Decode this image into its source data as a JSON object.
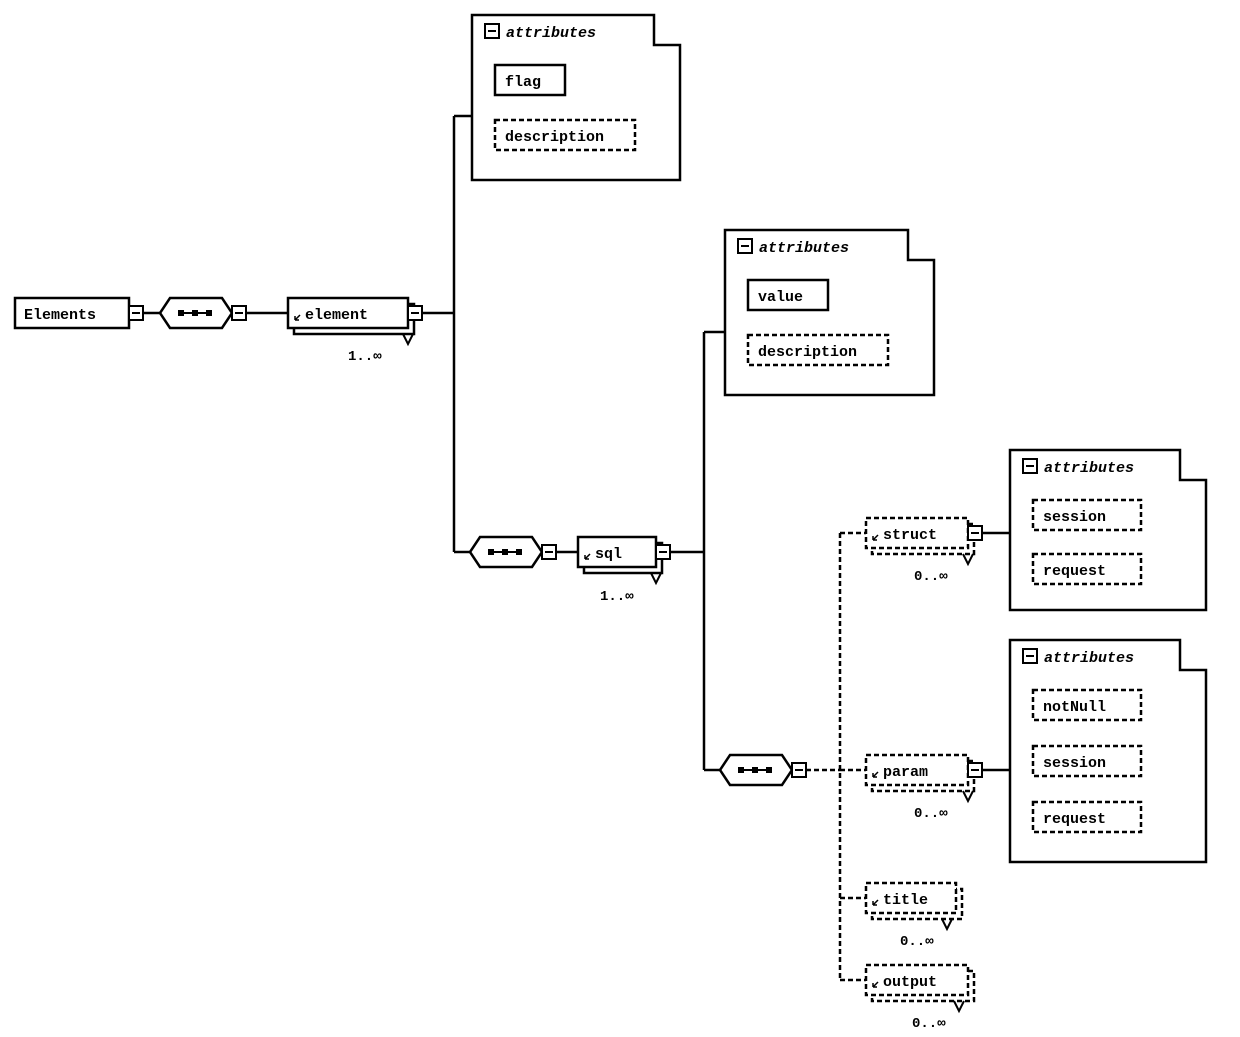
{
  "nodes": {
    "root": "Elements",
    "element": "element",
    "sql": "sql",
    "struct": "struct",
    "param": "param",
    "title": "title",
    "output": "output"
  },
  "attributes": {
    "element": {
      "title": "attributes",
      "items": [
        "flag",
        "description"
      ],
      "optional": [
        false,
        true
      ]
    },
    "sql": {
      "title": "attributes",
      "items": [
        "value",
        "description"
      ],
      "optional": [
        false,
        true
      ]
    },
    "struct": {
      "title": "attributes",
      "items": [
        "session",
        "request"
      ],
      "optional": [
        true,
        true
      ]
    },
    "param": {
      "title": "attributes",
      "items": [
        "notNull",
        "session",
        "request"
      ],
      "optional": [
        true,
        true,
        true
      ]
    }
  },
  "cardinalities": {
    "element": "1..∞",
    "sql": "1..∞",
    "struct": "0..∞",
    "param": "0..∞",
    "title": "0..∞",
    "output": "0..∞"
  }
}
